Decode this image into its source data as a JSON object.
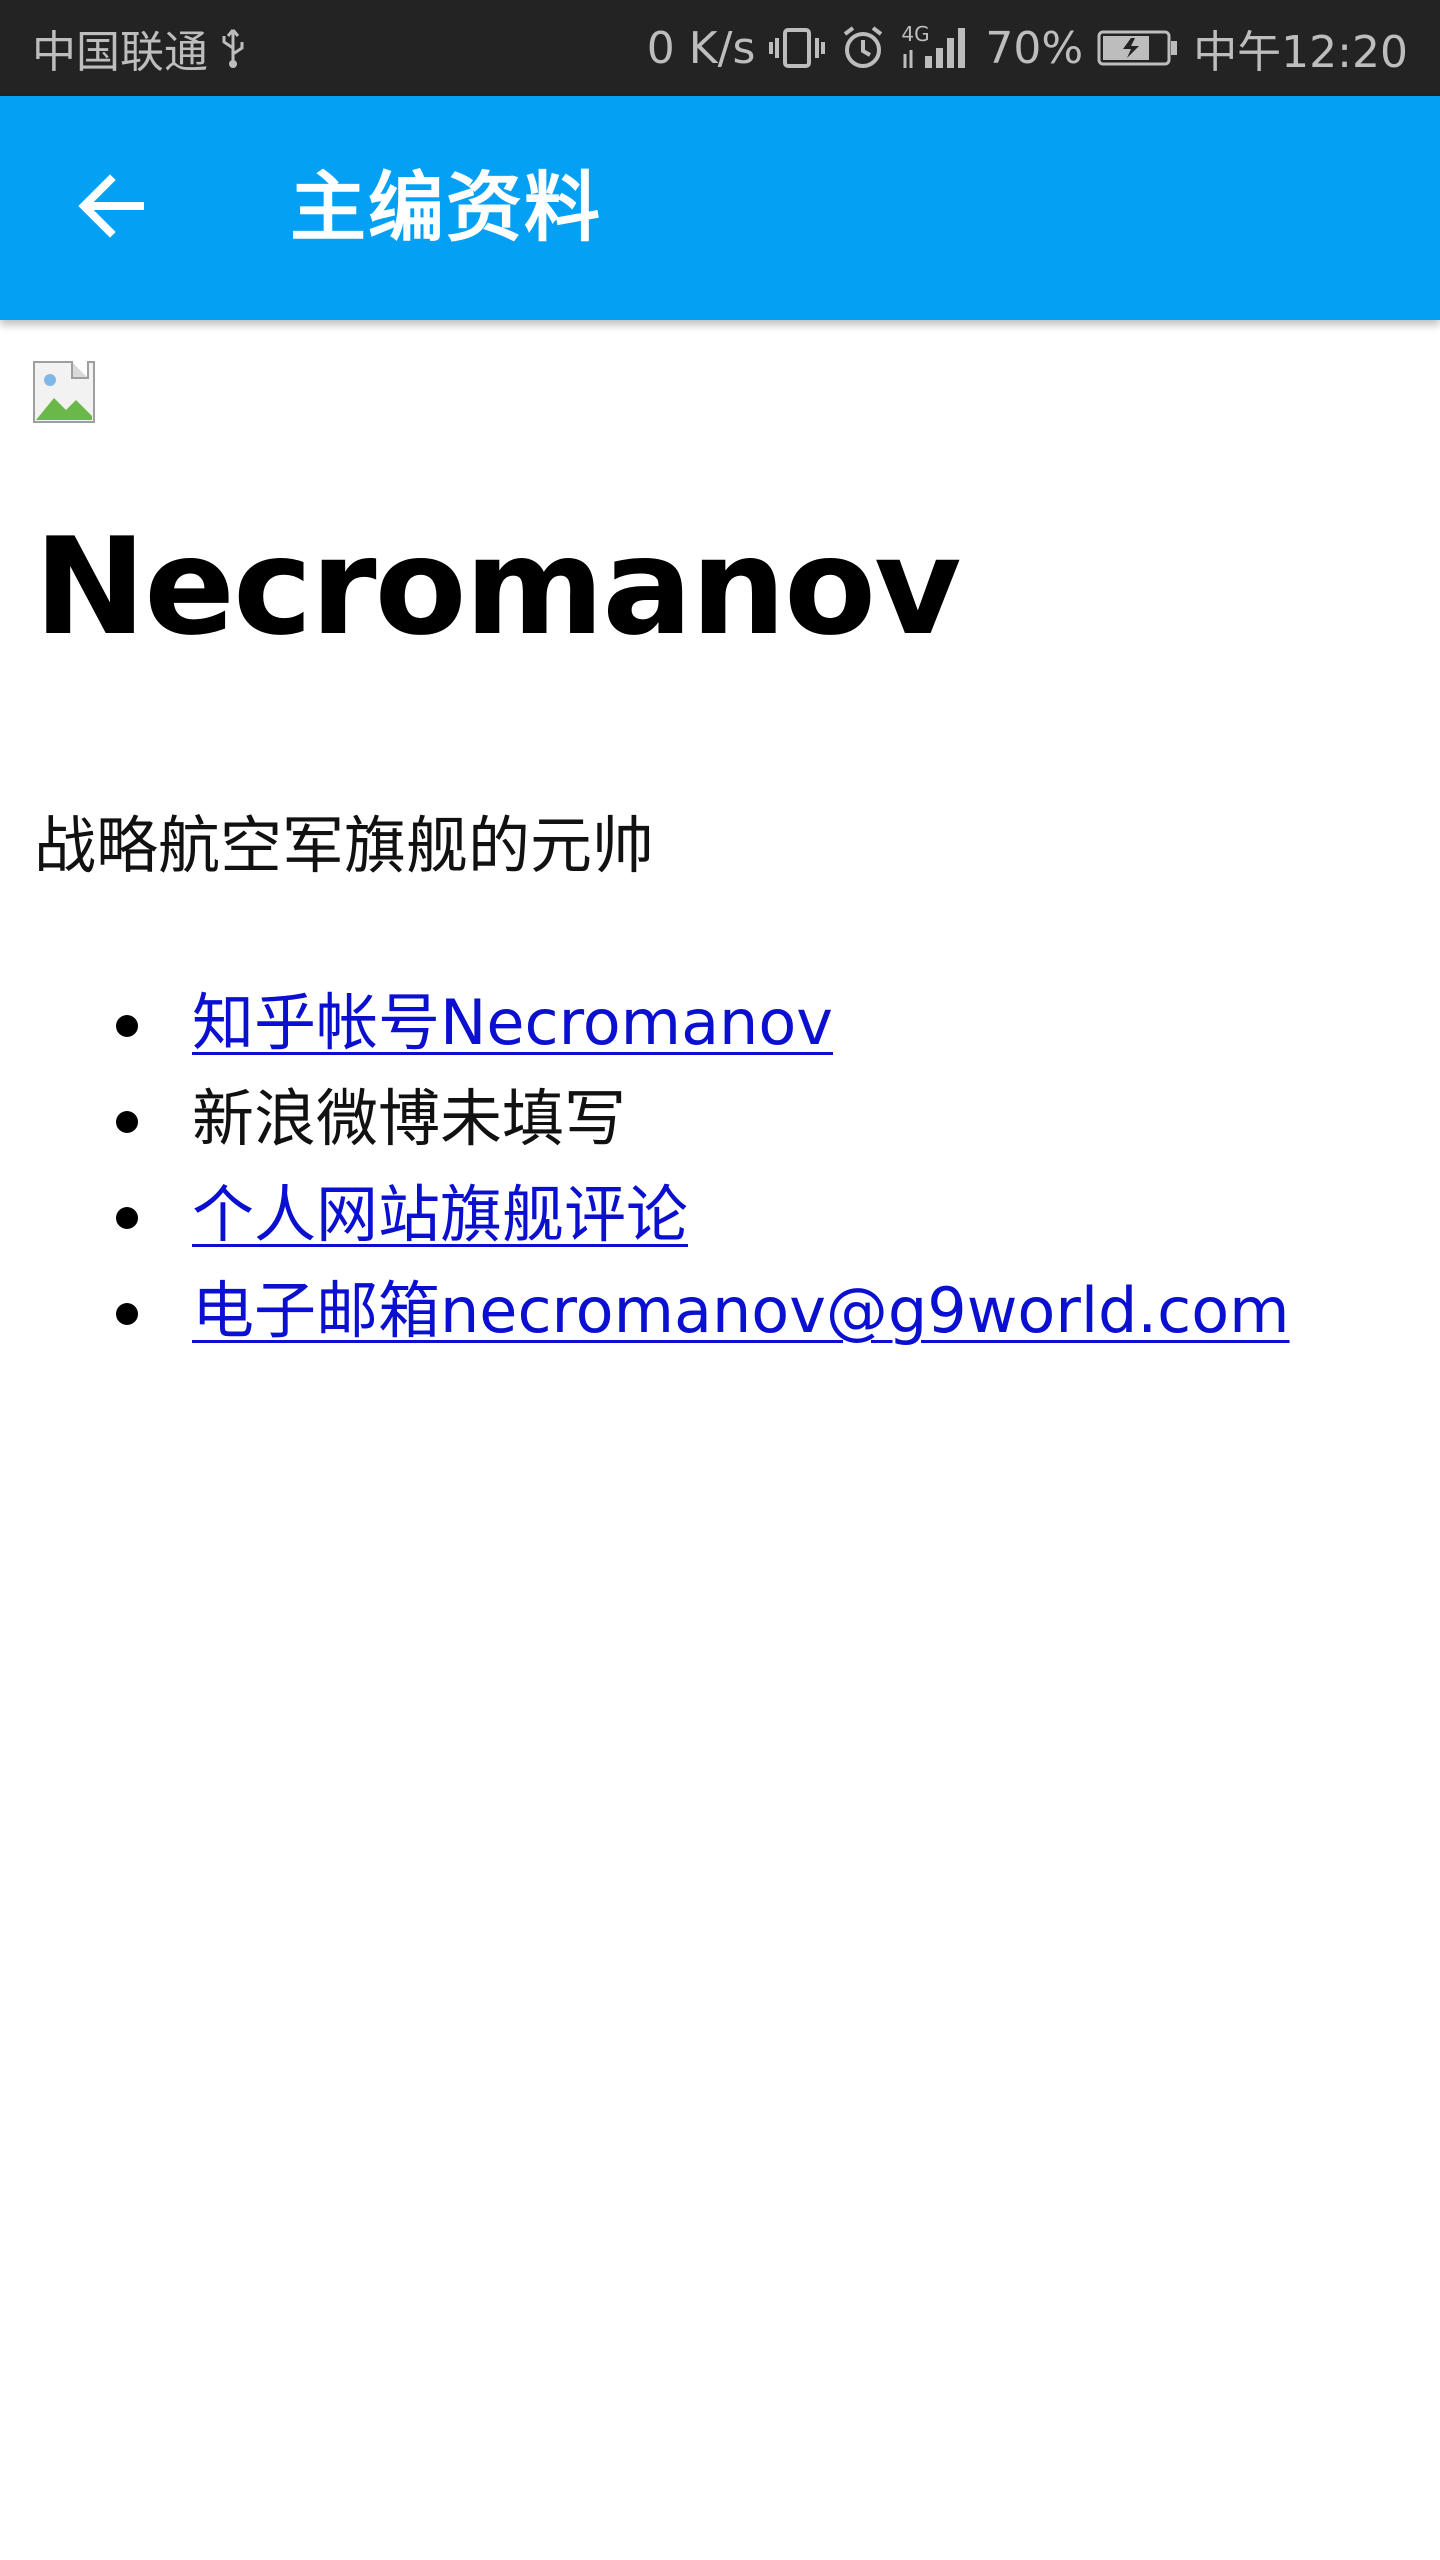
{
  "status_bar": {
    "carrier": "中国联通",
    "net_speed": "0 K/s",
    "network_type": "4G",
    "battery": "70%",
    "time": "中午12:20",
    "icons": [
      "usb-icon",
      "vibrate-icon",
      "alarm-icon",
      "signal-icon",
      "battery-charging-icon"
    ]
  },
  "app_bar": {
    "title": "主编资料",
    "back_icon": "arrow-left-icon",
    "color": "#03a0f4"
  },
  "profile": {
    "name": "Necromanov",
    "description": "战略航空军旗舰的元帅",
    "image_icon": "broken-image-icon",
    "items": [
      {
        "text": "知乎帐号Necromanov",
        "is_link": true
      },
      {
        "text": "新浪微博未填写",
        "is_link": false
      },
      {
        "text": "个人网站旗舰评论",
        "is_link": true
      },
      {
        "text": "电子邮箱necromanov@g9world.com",
        "is_link": true
      }
    ],
    "link_color": "#0a0fd0"
  }
}
